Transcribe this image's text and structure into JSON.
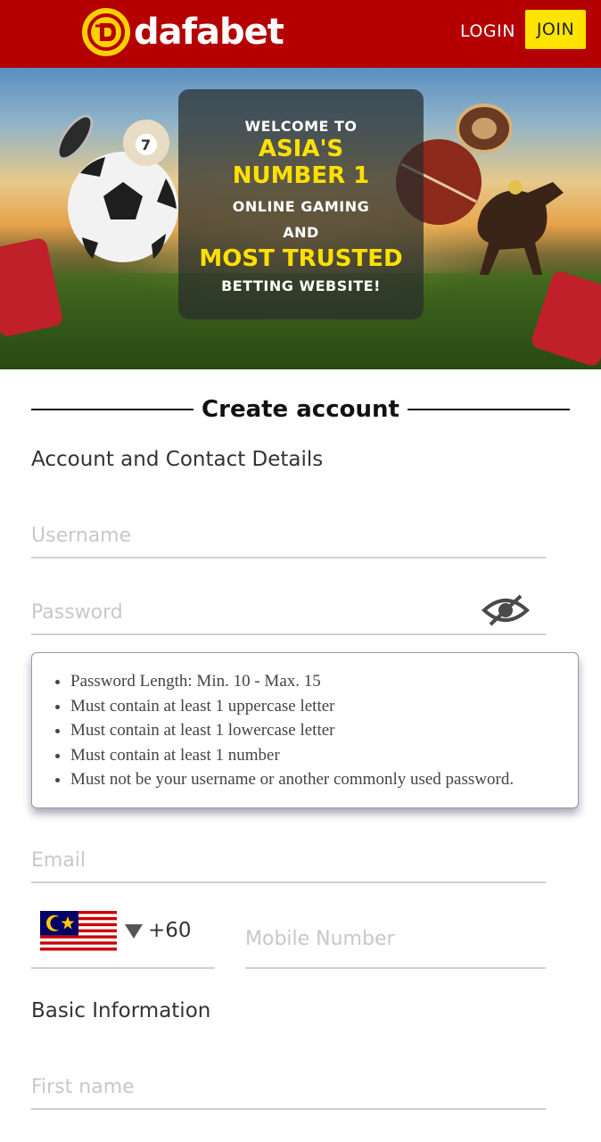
{
  "header": {
    "brand": "dafabet",
    "logo_icon": "dafabet-d-logo",
    "login_label": "LOGIN",
    "join_label": "JOIN",
    "colors": {
      "bar": "#b40000",
      "join_bg": "#ffe400",
      "logo_ring": "#ffd000"
    }
  },
  "banner": {
    "line1": "WELCOME TO",
    "line2": "ASIA'S NUMBER 1",
    "line3": "ONLINE GAMING",
    "line4": "AND",
    "line5": "MOST TRUSTED",
    "line6": "BETTING WEBSITE!",
    "accent_color": "#ffe000"
  },
  "form": {
    "title": "Create account",
    "account_section": "Account and Contact Details",
    "username_placeholder": "Username",
    "password_placeholder": "Password",
    "password_toggle_icon": "eye-slash-icon",
    "password_rules": [
      "Password Length: Min. 10 - Max. 15",
      "Must contain at least 1 uppercase letter",
      "Must contain at least 1 lowercase letter",
      "Must contain at least 1 number",
      "Must not be your username or another commonly used password."
    ],
    "email_placeholder": "Email",
    "country_flag_icon": "malaysia-flag-icon",
    "dial_code": "+60",
    "mobile_placeholder": "Mobile Number",
    "basic_section": "Basic Information",
    "first_name_placeholder": "First name"
  }
}
